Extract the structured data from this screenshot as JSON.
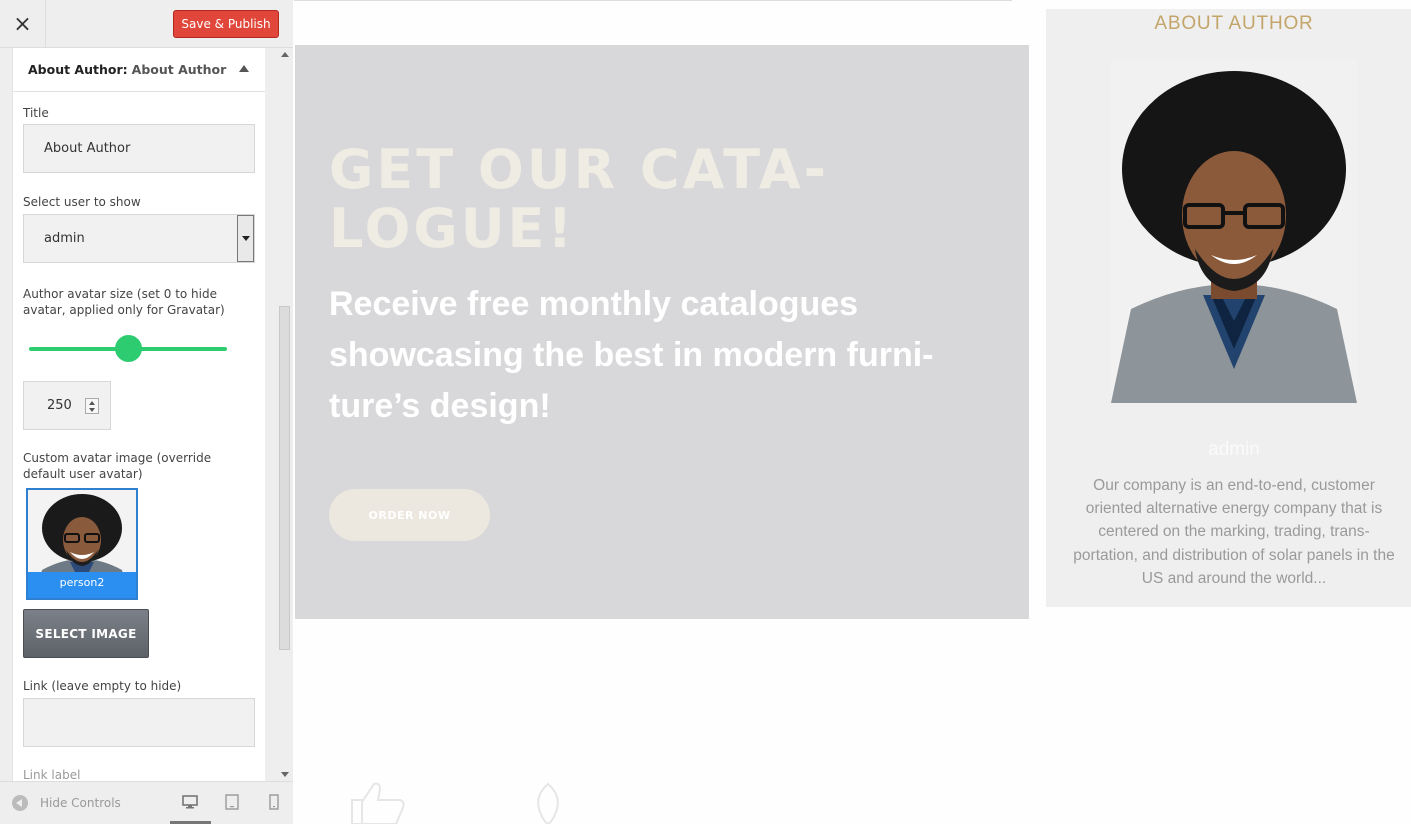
{
  "topbar": {
    "close_label": "×",
    "save_label": "Save & Publish"
  },
  "section": {
    "title": "About Author:",
    "subtitle": "About Author"
  },
  "form": {
    "title_label": "Title",
    "title_value": "About Author",
    "user_label": "Select user to show",
    "user_value": "admin",
    "avatar_size_label": "Author avatar size (set 0 to hide avatar, applied only for Gravatar)",
    "avatar_size_value": "250",
    "avatar_size_fraction": 0.5,
    "custom_avatar_label": "Custom avatar image (override default user avatar)",
    "avatar_filename": "person2",
    "select_image_label": "SELECT IMAGE",
    "link_label": "Link (leave empty to hide)",
    "link_value": "",
    "link_label_label": "Link label"
  },
  "footer": {
    "hide_controls": "Hide Controls"
  },
  "banner": {
    "title": "GET OUR CATA-LOGUE!",
    "text": "Receive free monthly catalogues showcasing the best in modern furni-ture’s design!",
    "button": "ORDER NOW"
  },
  "author": {
    "heading": "ABOUT AUTHOR",
    "name": "admin",
    "bio": "Our company is an end-to-end, customer oriented alternative energy company that is centered on the marking, trading, trans-portation, and distribution of solar panels in the US and around the world..."
  },
  "colors": {
    "save_button": "#e0463a",
    "slider": "#2ecc71",
    "accent_gold": "#c3a56a",
    "banner_bg": "#d8d8da",
    "avatar_highlight": "#2a8ff0"
  }
}
